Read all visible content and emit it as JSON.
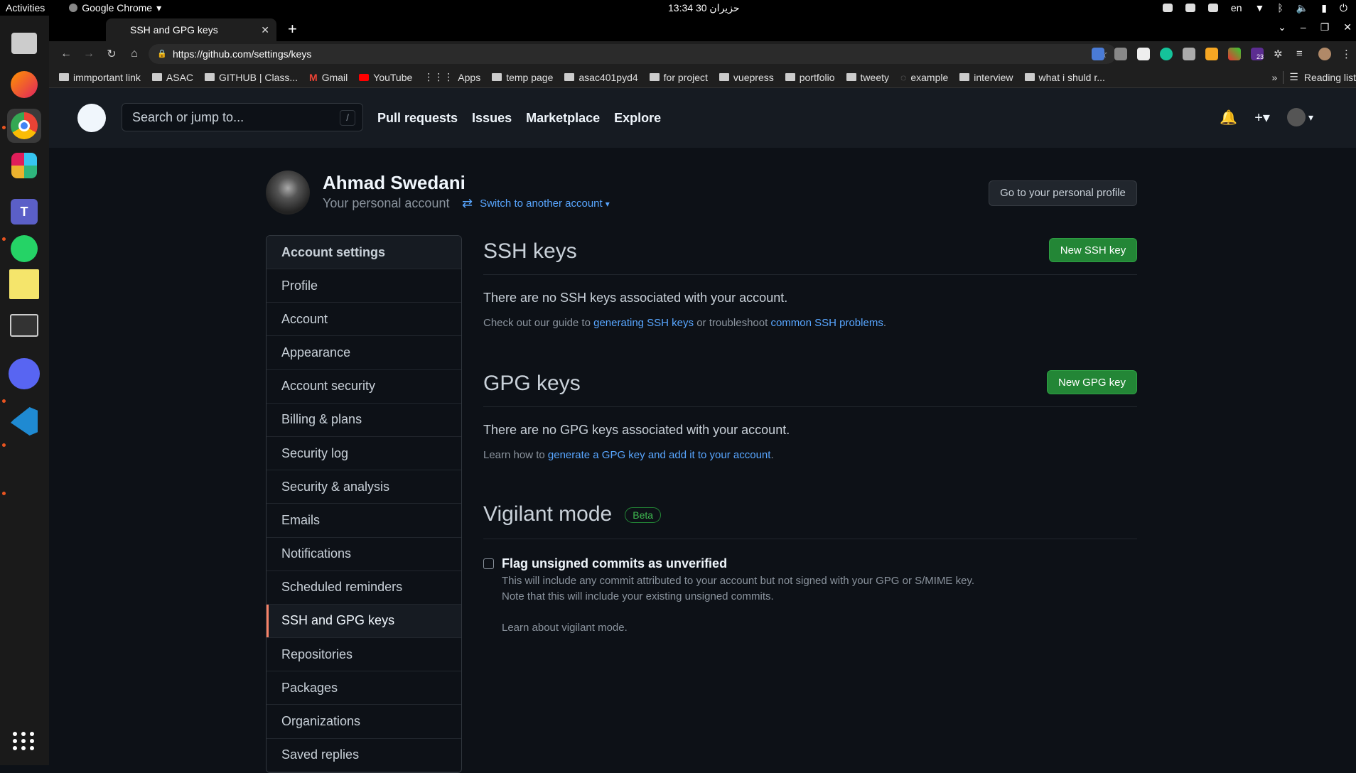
{
  "os": {
    "activities": "Activities",
    "app_name": "Google Chrome",
    "clock": "حزيران 30 13:34",
    "lang": "en"
  },
  "chrome": {
    "tab_title": "SSH and GPG keys",
    "url": "https://github.com/settings/keys",
    "bookmarks": [
      "immportant link",
      "ASAC",
      "GITHUB | Class...",
      "Gmail",
      "YouTube",
      "Apps",
      "temp page",
      "asac401pyd4",
      "for project",
      "vuepress",
      "portfolio",
      "tweety",
      "example",
      "interview",
      "what i shuld r..."
    ],
    "reading_list": "Reading list",
    "ext_badge": "23"
  },
  "github": {
    "search_placeholder": "Search or jump to...",
    "search_key": "/",
    "nav": [
      "Pull requests",
      "Issues",
      "Marketplace",
      "Explore"
    ]
  },
  "account": {
    "name": "Ahmad Swedani",
    "subtitle": "Your personal account",
    "switch_label": "Switch to another account",
    "profile_button": "Go to your personal profile"
  },
  "sidebar": {
    "heading": "Account settings",
    "items": [
      "Profile",
      "Account",
      "Appearance",
      "Account security",
      "Billing & plans",
      "Security log",
      "Security & analysis",
      "Emails",
      "Notifications",
      "Scheduled reminders",
      "SSH and GPG keys",
      "Repositories",
      "Packages",
      "Organizations",
      "Saved replies"
    ],
    "selected": "SSH and GPG keys"
  },
  "ssh": {
    "title": "SSH keys",
    "button": "New SSH key",
    "empty": "There are no SSH keys associated with your account.",
    "hint_prefix": "Check out our guide to ",
    "hint_link1": "generating SSH keys",
    "hint_mid": " or troubleshoot ",
    "hint_link2": "common SSH problems",
    "hint_suffix": "."
  },
  "gpg": {
    "title": "GPG keys",
    "button": "New GPG key",
    "empty": "There are no GPG keys associated with your account.",
    "hint_prefix": "Learn how to ",
    "hint_link": "generate a GPG key and add it to your account",
    "hint_suffix": "."
  },
  "vigilant": {
    "title": "Vigilant mode",
    "badge": "Beta",
    "checkbox_label": "Flag unsigned commits as unverified",
    "note1": "This will include any commit attributed to your account but not signed with your GPG or S/MIME key.",
    "note2": "Note that this will include your existing unsigned commits.",
    "learn_link": "Learn about vigilant mode."
  },
  "colors": {
    "bg": "#0d1117",
    "header": "#161b22",
    "link": "#58a6ff",
    "green": "#238636",
    "selected_bar": "#f78166"
  }
}
